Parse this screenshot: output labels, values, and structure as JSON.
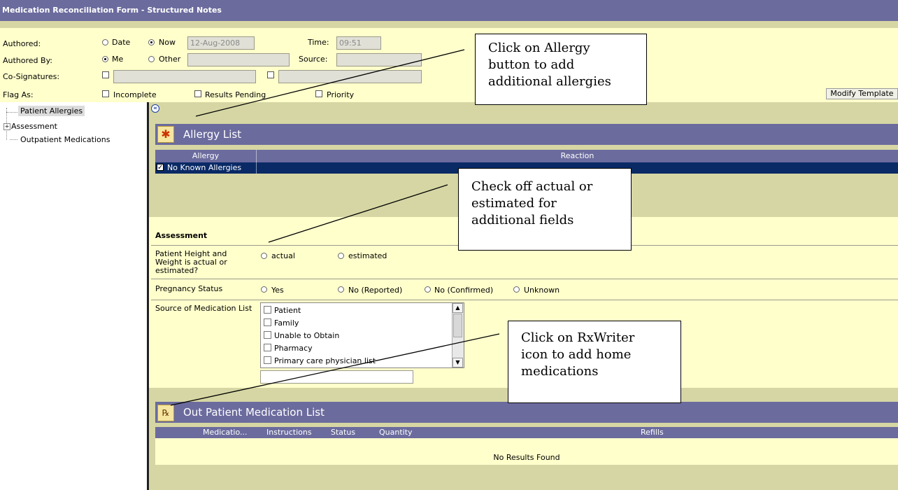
{
  "window": {
    "title": "Medication Reconciliation Form - Structured Notes"
  },
  "header": {
    "authored_label": "Authored:",
    "date_option": "Date",
    "now_option": "Now",
    "date_value": "12-Aug-2008",
    "time_label": "Time:",
    "time_value": "09:51",
    "authored_by_label": "Authored By:",
    "me_option": "Me",
    "other_option": "Other",
    "source_label": "Source:",
    "cosign_label": "Co-Signatures:",
    "flag_label": "Flag As:",
    "flag_incomplete": "Incomplete",
    "flag_results_pending": "Results Pending",
    "flag_priority": "Priority",
    "modify_button": "Modify Template"
  },
  "tree": {
    "items": [
      "Patient Allergies",
      "Assessment",
      "Outpatient Medications"
    ]
  },
  "allergy": {
    "title": "Allergy List",
    "col_allergy": "Allergy",
    "col_reaction": "Reaction",
    "row_label": "No Known Allergies"
  },
  "assessment": {
    "title": "Assessment",
    "height_label_1": "Patient Height and",
    "height_label_2": "Weight is actual or",
    "height_label_3": "estimated?",
    "actual": "actual",
    "estimated": "estimated",
    "pregnancy_label": "Pregnancy Status",
    "preg_yes": "Yes",
    "preg_no_reported": "No (Reported)",
    "preg_no_confirmed": "No (Confirmed)",
    "preg_unknown": "Unknown",
    "source_label": "Source of Medication List",
    "source_options": [
      "Patient",
      "Family",
      "Unable to Obtain",
      "Pharmacy",
      "Primary care physician list"
    ]
  },
  "outpatient": {
    "title": "Out Patient Medication List",
    "col_medication": "Medicatio...",
    "col_instructions": "Instructions",
    "col_status": "Status",
    "col_quantity": "Quantity",
    "col_refills": "Refills",
    "empty_message": "No Results Found"
  },
  "callouts": {
    "allergy_1": "Click on Allergy",
    "allergy_2": "button to add",
    "allergy_3": "additional allergies",
    "estimate_1": "Check off actual or",
    "estimate_2": "estimated for",
    "estimate_3": "additional fields",
    "rxwriter_1": "Click on RxWriter",
    "rxwriter_2": "icon to add home",
    "rxwriter_3": "medications"
  },
  "colors": {
    "title_bar": "#6b6b9e",
    "header_bg": "#ffffcc",
    "content_bg": "#d6d6a4",
    "selected_row": "#0a2a66"
  },
  "icons": [
    "allergy-person-icon",
    "rxwriter-icon",
    "collapse-icon",
    "expand-plus-icon"
  ]
}
